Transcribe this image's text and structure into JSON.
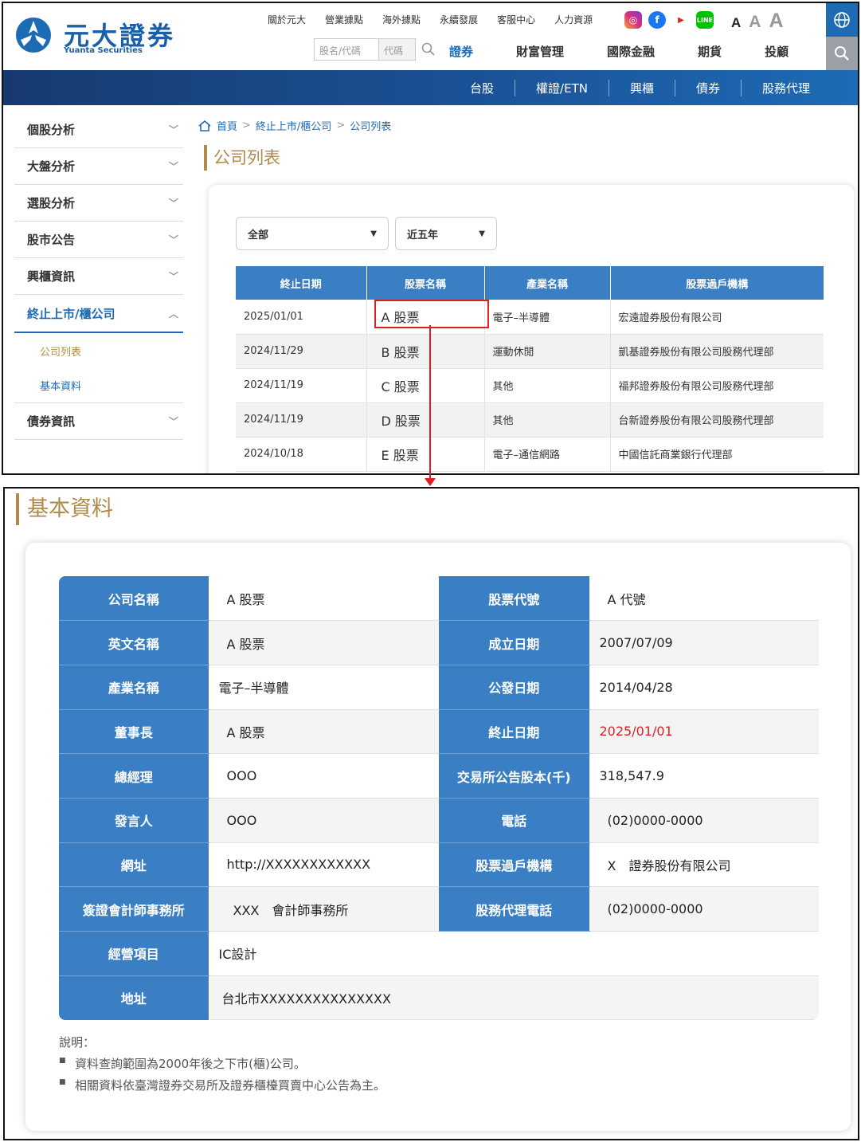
{
  "header": {
    "logo_text": "元大證券",
    "logo_sub": "Yuanta Securities",
    "top_links": [
      "關於元大",
      "營業據點",
      "海外據點",
      "永續發展",
      "客服中心",
      "人力資源"
    ],
    "font_sizes": [
      "A",
      "A",
      "A"
    ],
    "search_placeholder": "股名/代碼",
    "search_code_label": "代碼",
    "main_nav": [
      "證券",
      "財富管理",
      "國際金融",
      "期貨",
      "投顧"
    ],
    "sub_nav": [
      "台股",
      "權證/ETN",
      "興櫃",
      "債券",
      "股務代理"
    ]
  },
  "sidebar": {
    "items": [
      "個股分析",
      "大盤分析",
      "選股分析",
      "股市公告",
      "興櫃資訊",
      "終止上市/櫃公司",
      "債券資訊"
    ],
    "sub_items": [
      "公司列表",
      "基本資料"
    ]
  },
  "breadcrumb": [
    "首頁",
    "終止上市/櫃公司",
    "公司列表"
  ],
  "list_page": {
    "title": "公司列表",
    "filter_category": "全部",
    "filter_period": "近五年",
    "columns": [
      "終止日期",
      "股票名稱",
      "產業名稱",
      "股票過戶機構"
    ],
    "rows": [
      {
        "date": "2025/01/01",
        "name": "A 股票",
        "industry": "電子–半導體",
        "agent": "宏遠證券股份有限公司"
      },
      {
        "date": "2024/11/29",
        "name": "B 股票",
        "industry": "運動休閒",
        "agent": "凱基證券股份有限公司股務代理部"
      },
      {
        "date": "2024/11/19",
        "name": "C 股票",
        "industry": "其他",
        "agent": "福邦證券股份有限公司股務代理部"
      },
      {
        "date": "2024/11/19",
        "name": "D 股票",
        "industry": "其他",
        "agent": "台新證券股份有限公司股務代理部"
      },
      {
        "date": "2024/10/18",
        "name": "E 股票",
        "industry": "電子–通信網路",
        "agent": "中國信託商業銀行代理部"
      }
    ]
  },
  "detail_page": {
    "title": "基本資料",
    "fields": {
      "company_name_label": "公司名稱",
      "company_name": "A 股票",
      "stock_code_label": "股票代號",
      "stock_code": "A 代號",
      "english_name_label": "英文名稱",
      "english_name": "A 股票",
      "founded_label": "成立日期",
      "founded": "2007/07/09",
      "industry_label": "產業名稱",
      "industry": "電子–半導體",
      "public_label": "公發日期",
      "public_date": "2014/04/28",
      "chairman_label": "董事長",
      "chairman": "A 股票",
      "delisted_label": "終止日期",
      "delisted": "2025/01/01",
      "gm_label": "總經理",
      "gm": "OOO",
      "capital_label": "交易所公告股本(千)",
      "capital": "318,547.9",
      "spokesman_label": "發言人",
      "spokesman": "OOO",
      "phone_label": "電話",
      "phone": "(02)0000-0000",
      "website_label": "網址",
      "website": "http://XXXXXXXXXXXX",
      "transfer_label": "股票過戶機構",
      "transfer_agent": "X　證券股份有限公司",
      "cpa_label": "簽證會計師事務所",
      "cpa": "XXX　會計師事務所",
      "agent_phone_label": "股務代理電話",
      "agent_phone": "(02)0000-0000",
      "business_label": "經營項目",
      "business": "IC設計",
      "address_label": "地址",
      "address": "台北市XXXXXXXXXXXXXXX"
    },
    "notes_title": "說明：",
    "notes": [
      "資料查詢範圍為2000年後之下市(櫃)公司。",
      "相關資料依臺灣證券交易所及證券櫃檯買賣中心公告為主。"
    ]
  },
  "colors": {
    "brand_blue": "#1d6bb5",
    "header_blue": "#3a7fc4",
    "gold": "#b08a4a",
    "highlight_red": "#e01e1e"
  },
  "icons": [
    "logo-mark-icon",
    "instagram-icon",
    "facebook-icon",
    "youtube-icon",
    "line-icon",
    "globe-icon",
    "search-icon",
    "home-icon",
    "chevron-down-icon",
    "chevron-up-icon",
    "caret-down-icon"
  ]
}
